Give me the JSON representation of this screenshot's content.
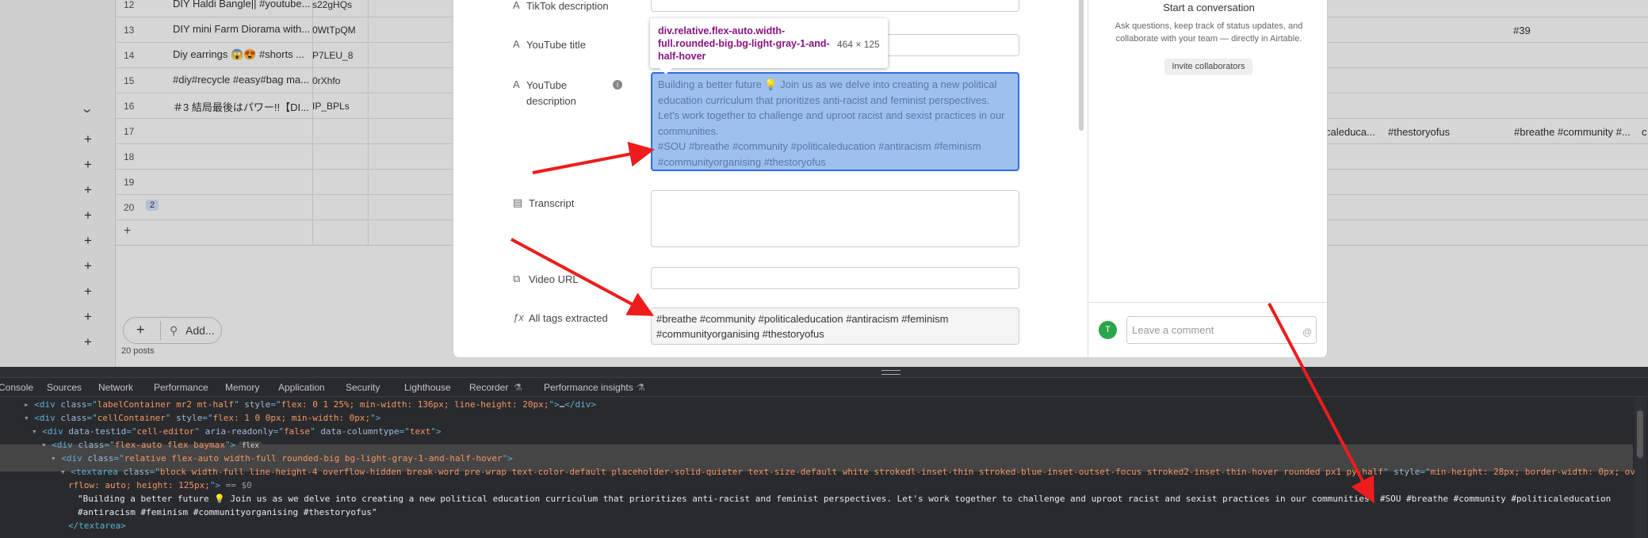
{
  "rows": [
    {
      "num": "12",
      "title": "DIY Haldi Bangle|| #youtube...",
      "id": "s22gHQs"
    },
    {
      "num": "13",
      "title": "DIY mini Farm Diorama with...",
      "id": "0WtTpQM"
    },
    {
      "num": "14",
      "title": "Diy earrings 😱😍 #shorts ...",
      "id": "P7LEU_8"
    },
    {
      "num": "15",
      "title": "#diy#recycle #easy#bag ma...",
      "id": "0rXhfo"
    },
    {
      "num": "16",
      "title": "＃3 結局最後はパワー!!【DI...",
      "id": "IP_BPLs"
    },
    {
      "num": "17",
      "title": "",
      "id": ""
    },
    {
      "num": "18",
      "title": "",
      "id": ""
    },
    {
      "num": "19",
      "title": "",
      "id": ""
    },
    {
      "num": "20",
      "title": "",
      "id": ""
    }
  ],
  "row20_badge": "2",
  "row13_extra": "#39",
  "row17_extra": [
    "caleduca...",
    "#thestoryofus",
    "#breathe #community #...",
    "c"
  ],
  "add_button_label": "Add...",
  "posts_count": "20 posts",
  "modal": {
    "fields": {
      "tiktok_description": "TikTok description",
      "youtube_title": "YouTube title",
      "youtube_description_line1": "YouTube",
      "youtube_description_line2": "description",
      "transcript": "Transcript",
      "video_url": "Video URL",
      "all_tags": "All tags extracted"
    },
    "youtube_description_value": "Building a better future 💡 Join us as we delve into creating a new political\neducation curriculum that prioritizes anti-racist and feminist perspectives.\nLet's work together to challenge and uproot racist and sexist practices in our\ncommunities.\n#SOU #breathe #community #politicaleducation #antiracism #feminism\n#communityorganising #thestoryofus",
    "all_tags_value": "#breathe #community #politicaleducation #antiracism #feminism\n#communityorganising #thestoryofus"
  },
  "sidebar": {
    "conversation_title": "Start a conversation",
    "conversation_subtitle": "Ask questions, keep track of status updates, and collaborate with your team — directly in Airtable.",
    "invite_label": "Invite collaborators",
    "avatar_initial": "T",
    "comment_placeholder": "Leave a comment",
    "mention_symbol": "@"
  },
  "tooltip": {
    "element_name": "div.relative.flex-auto.width-full.rounded-big.bg-light-gray-1-and-half-hover",
    "element_size": "464 × 125"
  },
  "devtools": {
    "tabs": [
      "Console",
      "Sources",
      "Network",
      "Performance",
      "Memory",
      "Application",
      "Security",
      "Lighthouse",
      "Recorder",
      "Performance insights"
    ],
    "lines": [
      {
        "parts": [
          [
            "tag",
            "<div "
          ],
          [
            "an",
            "class"
          ],
          [
            "tag",
            "=\""
          ],
          [
            "av",
            "labelContainer mr2 mt-half"
          ],
          [
            "tag",
            "\" "
          ],
          [
            "an",
            "style"
          ],
          [
            "tag",
            "=\""
          ],
          [
            "av",
            "flex: 0 1 25%; min-width: 136px; line-height: 20px;"
          ],
          [
            "tag",
            "\">"
          ],
          [
            "txt",
            "…"
          ],
          [
            "tag",
            "</div>"
          ]
        ]
      },
      {
        "parts": [
          [
            "tag",
            "<div "
          ],
          [
            "an",
            "class"
          ],
          [
            "tag",
            "=\""
          ],
          [
            "av",
            "cellContainer"
          ],
          [
            "tag",
            "\" "
          ],
          [
            "an",
            "style"
          ],
          [
            "tag",
            "=\""
          ],
          [
            "av",
            "flex: 1 0 0px; min-width: 0px;"
          ],
          [
            "tag",
            "\">"
          ]
        ]
      },
      {
        "parts": [
          [
            "tag",
            "<div "
          ],
          [
            "an",
            "data-testid"
          ],
          [
            "tag",
            "=\""
          ],
          [
            "av",
            "cell-editor"
          ],
          [
            "tag",
            "\" "
          ],
          [
            "an",
            "aria-readonly"
          ],
          [
            "tag",
            "=\""
          ],
          [
            "av",
            "false"
          ],
          [
            "tag",
            "\" "
          ],
          [
            "an",
            "data-columntype"
          ],
          [
            "tag",
            "=\""
          ],
          [
            "av",
            "text"
          ],
          [
            "tag",
            "\">"
          ]
        ]
      },
      {
        "parts": [
          [
            "tag",
            "<div "
          ],
          [
            "an",
            "class"
          ],
          [
            "tag",
            "=\""
          ],
          [
            "av",
            "flex-auto flex baymax"
          ],
          [
            "tag",
            "\">"
          ]
        ]
      },
      {
        "parts": [
          [
            "tag",
            "<div "
          ],
          [
            "an",
            "class"
          ],
          [
            "tag",
            "=\""
          ],
          [
            "av",
            "relative flex-auto width-full rounded-big bg-light-gray-1-and-half-hover"
          ],
          [
            "tag",
            "\">"
          ]
        ]
      },
      {
        "parts": [
          [
            "tag",
            "<textarea "
          ],
          [
            "an",
            "class"
          ],
          [
            "tag",
            "=\""
          ],
          [
            "av",
            "block width-full line-height-4 overflow-hidden break-word pre-wrap text-color-default placeholder-solid-quieter text-size-default white strokedl-inset-thin stroked-blue-inset-outset-focus stroked2-inset-thin-hover rounded px1 py-half"
          ],
          [
            "tag",
            "\" "
          ],
          [
            "an",
            "style"
          ],
          [
            "tag",
            "=\""
          ],
          [
            "av",
            "min-height: 28px; border-width: 0px; ove"
          ]
        ]
      },
      {
        "parts": [
          [
            "av",
            "rflow: auto; height: 125px;"
          ],
          [
            "tag",
            "\">"
          ],
          [
            "dollar",
            " == $0"
          ]
        ]
      },
      {
        "parts": [
          [
            "txt",
            "\"Building a better future 💡 Join us as we delve into creating a new political education curriculum that prioritizes anti-racist and feminist perspectives. Let's work together to challenge and uproot racist and sexist practices in our communities. #SOU #breathe #community #politicaleducation"
          ]
        ]
      },
      {
        "parts": [
          [
            "txt",
            "#antiracism #feminism #communityorganising #thestoryofus\""
          ]
        ]
      },
      {
        "parts": [
          [
            "tag",
            "</textarea>"
          ]
        ]
      }
    ],
    "flex_pill": "flex"
  }
}
